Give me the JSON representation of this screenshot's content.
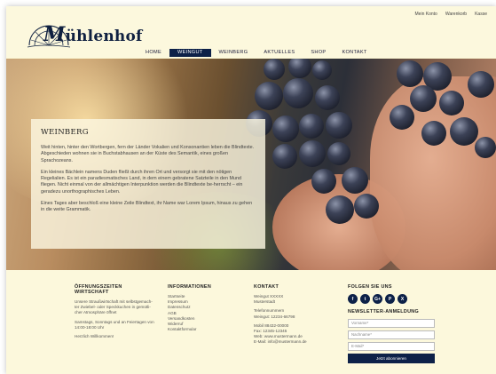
{
  "topnav": [
    "Mein Konto",
    "Warenkorb",
    "Kasse"
  ],
  "logo": {
    "lead": "M",
    "text": "ühlenhof"
  },
  "mainnav": [
    {
      "label": "HOME",
      "active": false
    },
    {
      "label": "WEINGUT",
      "active": true
    },
    {
      "label": "WEINBERG",
      "active": false
    },
    {
      "label": "AKTUELLES",
      "active": false
    },
    {
      "label": "SHOP",
      "active": false
    },
    {
      "label": "KONTAKT",
      "active": false
    }
  ],
  "content": {
    "title": "WEINBERG",
    "paragraphs": [
      "Weit hinten, hinter den Wortbergen, fern der Länder Vokalien und Konsonantien leben die Blindtexte. Abgeschieden wohnen sie in Buchstabhausen an der Küste des Semantik, eines großen Sprachozeans.",
      "Ein kleines Bächlein namens Duden fließt durch ihren Ort und versorgt sie mit den nötigen Regelialien. Es ist ein paradiesmatisches Land, in dem einem gebratene Satzteile in den Mund fliegen. Nicht einmal von der allmächtigen Interpunktion werden die Blindtexte be-herrscht – ein geradezu unorthographisches Leben.",
      "Eines Tages aber beschloß eine kleine Zeile Blindtext, ihr Name war Lorem Ipsum, hinaus zu gehen in die weite Grammatik."
    ]
  },
  "footer": {
    "hours": {
      "title": "ÖFFNUNGSZEITEN WIRTSCHAFT",
      "lines": [
        "Unsere Straußwirtschaft mit selbstgemach-ter Zwiebel- oder Speckkuchen in gemütli-cher Atmosphäre öffnet",
        "Samstags, Sonntags und an Feiertagen von 14:00-18:00 Uhr",
        "Herzlich Willkommen!"
      ]
    },
    "info": {
      "title": "INFORMATIONEN",
      "links": [
        "Startseite",
        "Impressum",
        "Datenschutz",
        "AGB",
        "Versandkosten",
        "Widerruf",
        "Kontaktformular"
      ]
    },
    "contact": {
      "title": "KONTAKT",
      "blocks": [
        [
          "Weingut XXXXX",
          "Musterstadt"
        ],
        [
          "Telefonnummern",
          "Weingut: 12234-66798"
        ],
        [
          "Mobil 88432-00000",
          "Fax: 12345-12345",
          "Web: www.mustermann.de",
          "E-Mail: info@mustermann.de"
        ]
      ]
    },
    "follow": {
      "title": "FOLGEN SIE UNS",
      "icons": [
        {
          "name": "facebook-icon",
          "glyph": "f"
        },
        {
          "name": "twitter-icon",
          "glyph": "t"
        },
        {
          "name": "google-plus-icon",
          "glyph": "G+"
        },
        {
          "name": "pinterest-icon",
          "glyph": "P"
        },
        {
          "name": "xing-icon",
          "glyph": "X"
        }
      ]
    },
    "newsletter": {
      "title": "NEWSLETTER-ANMELDUNG",
      "firstname_placeholder": "Vorname*",
      "lastname_placeholder": "Nachname*",
      "email_placeholder": "E-Mail*",
      "button": "Jetzt abonnieren"
    }
  },
  "colors": {
    "navy": "#0d2148",
    "cream": "#fbf6d3"
  }
}
